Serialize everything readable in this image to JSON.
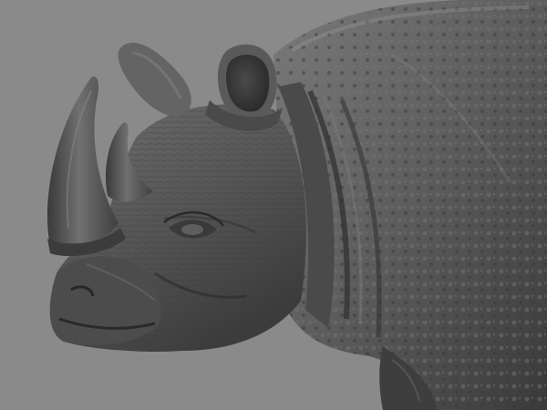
{
  "scene": {
    "subject": "sculpted-rhinoceros-head",
    "background_color": "#8a8a8a",
    "skin_base_color": "#5a5a5a",
    "skin_highlight_color": "#8c8c8c",
    "skin_shadow_color": "#2e2e2e",
    "horn_color": "#4a4a4a"
  }
}
